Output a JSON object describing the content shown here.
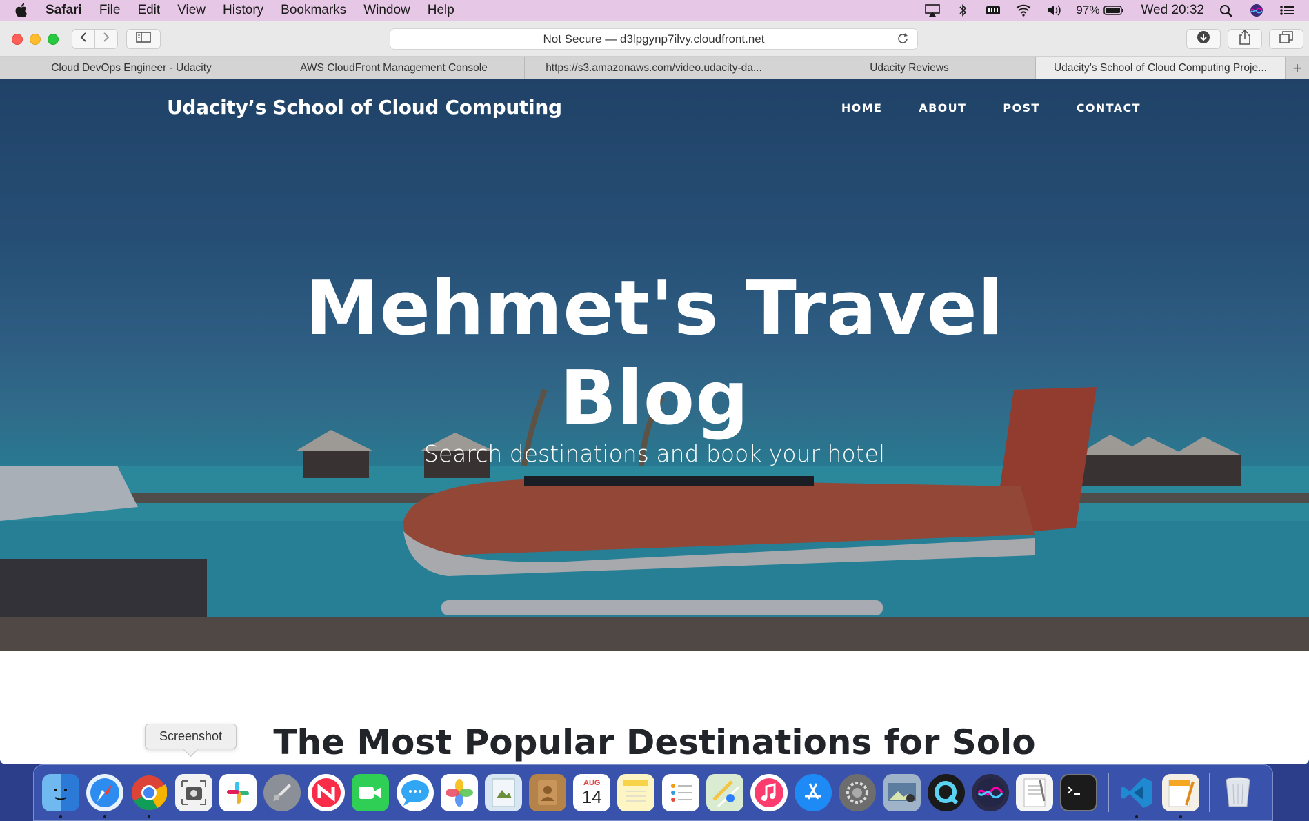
{
  "menubar": {
    "app_name": "Safari",
    "items": [
      "File",
      "Edit",
      "View",
      "History",
      "Bookmarks",
      "Window",
      "Help"
    ],
    "battery": "97%",
    "clock": "Wed 20:32"
  },
  "toolbar": {
    "address": "Not Secure — d3lpgynp7ilvy.cloudfront.net"
  },
  "tabs": [
    "Cloud DevOps Engineer - Udacity",
    "AWS CloudFront Management Console",
    "https://s3.amazonaws.com/video.udacity-da...",
    "Udacity Reviews",
    "Udacity’s School of Cloud Computing Proje..."
  ],
  "page": {
    "brand": "Udacity’s School of Cloud Computing",
    "nav": [
      "HOME",
      "ABOUT",
      "POST",
      "CONTACT"
    ],
    "hero_title_line1": "Mehmet's Travel",
    "hero_title_line2": "Blog",
    "hero_subtitle": "Search destinations and book your hotel",
    "section_title": "The Most Popular Destinations for Solo"
  },
  "tooltip": "Screenshot",
  "dock": {
    "calendar_month": "AUG",
    "calendar_day": "14",
    "apps": [
      "finder",
      "safari",
      "chrome",
      "screenshot",
      "slack",
      "launchpad",
      "news",
      "facetime",
      "messages",
      "photos",
      "preview",
      "contacts",
      "calendar",
      "notes",
      "reminders",
      "maps",
      "music",
      "app-store",
      "system-preferences",
      "image-capture",
      "quicktime",
      "siri",
      "textedit",
      "terminal",
      "vscode",
      "pages",
      "trash"
    ]
  },
  "colors": {
    "menubar": "#e7c7e6",
    "hero_top": "#26527f",
    "hero_water": "#3fb9c8",
    "heading": "#212529"
  }
}
